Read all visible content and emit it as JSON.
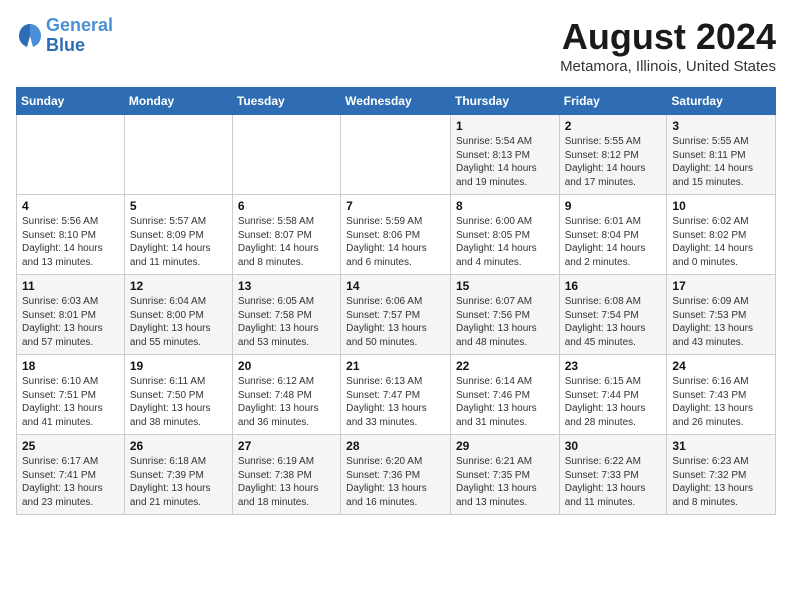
{
  "header": {
    "logo_line1": "General",
    "logo_line2": "Blue",
    "month_title": "August 2024",
    "location": "Metamora, Illinois, United States"
  },
  "weekdays": [
    "Sunday",
    "Monday",
    "Tuesday",
    "Wednesday",
    "Thursday",
    "Friday",
    "Saturday"
  ],
  "weeks": [
    [
      {
        "day": "",
        "info": ""
      },
      {
        "day": "",
        "info": ""
      },
      {
        "day": "",
        "info": ""
      },
      {
        "day": "",
        "info": ""
      },
      {
        "day": "1",
        "info": "Sunrise: 5:54 AM\nSunset: 8:13 PM\nDaylight: 14 hours\nand 19 minutes."
      },
      {
        "day": "2",
        "info": "Sunrise: 5:55 AM\nSunset: 8:12 PM\nDaylight: 14 hours\nand 17 minutes."
      },
      {
        "day": "3",
        "info": "Sunrise: 5:55 AM\nSunset: 8:11 PM\nDaylight: 14 hours\nand 15 minutes."
      }
    ],
    [
      {
        "day": "4",
        "info": "Sunrise: 5:56 AM\nSunset: 8:10 PM\nDaylight: 14 hours\nand 13 minutes."
      },
      {
        "day": "5",
        "info": "Sunrise: 5:57 AM\nSunset: 8:09 PM\nDaylight: 14 hours\nand 11 minutes."
      },
      {
        "day": "6",
        "info": "Sunrise: 5:58 AM\nSunset: 8:07 PM\nDaylight: 14 hours\nand 8 minutes."
      },
      {
        "day": "7",
        "info": "Sunrise: 5:59 AM\nSunset: 8:06 PM\nDaylight: 14 hours\nand 6 minutes."
      },
      {
        "day": "8",
        "info": "Sunrise: 6:00 AM\nSunset: 8:05 PM\nDaylight: 14 hours\nand 4 minutes."
      },
      {
        "day": "9",
        "info": "Sunrise: 6:01 AM\nSunset: 8:04 PM\nDaylight: 14 hours\nand 2 minutes."
      },
      {
        "day": "10",
        "info": "Sunrise: 6:02 AM\nSunset: 8:02 PM\nDaylight: 14 hours\nand 0 minutes."
      }
    ],
    [
      {
        "day": "11",
        "info": "Sunrise: 6:03 AM\nSunset: 8:01 PM\nDaylight: 13 hours\nand 57 minutes."
      },
      {
        "day": "12",
        "info": "Sunrise: 6:04 AM\nSunset: 8:00 PM\nDaylight: 13 hours\nand 55 minutes."
      },
      {
        "day": "13",
        "info": "Sunrise: 6:05 AM\nSunset: 7:58 PM\nDaylight: 13 hours\nand 53 minutes."
      },
      {
        "day": "14",
        "info": "Sunrise: 6:06 AM\nSunset: 7:57 PM\nDaylight: 13 hours\nand 50 minutes."
      },
      {
        "day": "15",
        "info": "Sunrise: 6:07 AM\nSunset: 7:56 PM\nDaylight: 13 hours\nand 48 minutes."
      },
      {
        "day": "16",
        "info": "Sunrise: 6:08 AM\nSunset: 7:54 PM\nDaylight: 13 hours\nand 45 minutes."
      },
      {
        "day": "17",
        "info": "Sunrise: 6:09 AM\nSunset: 7:53 PM\nDaylight: 13 hours\nand 43 minutes."
      }
    ],
    [
      {
        "day": "18",
        "info": "Sunrise: 6:10 AM\nSunset: 7:51 PM\nDaylight: 13 hours\nand 41 minutes."
      },
      {
        "day": "19",
        "info": "Sunrise: 6:11 AM\nSunset: 7:50 PM\nDaylight: 13 hours\nand 38 minutes."
      },
      {
        "day": "20",
        "info": "Sunrise: 6:12 AM\nSunset: 7:48 PM\nDaylight: 13 hours\nand 36 minutes."
      },
      {
        "day": "21",
        "info": "Sunrise: 6:13 AM\nSunset: 7:47 PM\nDaylight: 13 hours\nand 33 minutes."
      },
      {
        "day": "22",
        "info": "Sunrise: 6:14 AM\nSunset: 7:46 PM\nDaylight: 13 hours\nand 31 minutes."
      },
      {
        "day": "23",
        "info": "Sunrise: 6:15 AM\nSunset: 7:44 PM\nDaylight: 13 hours\nand 28 minutes."
      },
      {
        "day": "24",
        "info": "Sunrise: 6:16 AM\nSunset: 7:43 PM\nDaylight: 13 hours\nand 26 minutes."
      }
    ],
    [
      {
        "day": "25",
        "info": "Sunrise: 6:17 AM\nSunset: 7:41 PM\nDaylight: 13 hours\nand 23 minutes."
      },
      {
        "day": "26",
        "info": "Sunrise: 6:18 AM\nSunset: 7:39 PM\nDaylight: 13 hours\nand 21 minutes."
      },
      {
        "day": "27",
        "info": "Sunrise: 6:19 AM\nSunset: 7:38 PM\nDaylight: 13 hours\nand 18 minutes."
      },
      {
        "day": "28",
        "info": "Sunrise: 6:20 AM\nSunset: 7:36 PM\nDaylight: 13 hours\nand 16 minutes."
      },
      {
        "day": "29",
        "info": "Sunrise: 6:21 AM\nSunset: 7:35 PM\nDaylight: 13 hours\nand 13 minutes."
      },
      {
        "day": "30",
        "info": "Sunrise: 6:22 AM\nSunset: 7:33 PM\nDaylight: 13 hours\nand 11 minutes."
      },
      {
        "day": "31",
        "info": "Sunrise: 6:23 AM\nSunset: 7:32 PM\nDaylight: 13 hours\nand 8 minutes."
      }
    ]
  ]
}
